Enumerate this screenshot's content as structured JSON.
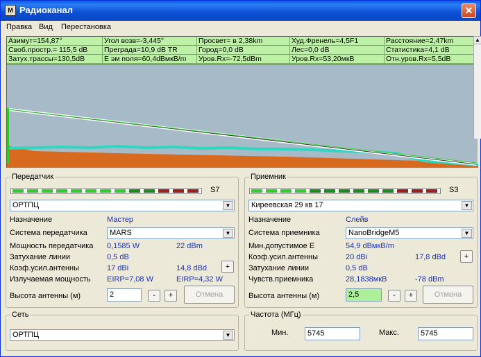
{
  "window": {
    "title": "Радиоканал",
    "app_icon": "radio-app-icon",
    "close_glyph": "✕"
  },
  "menu": [
    "Правка",
    "Вид",
    "Перестановка"
  ],
  "info": [
    [
      "Азимут=154,87°",
      "Угол возв=-3,445°",
      "Просвет= в 2,38km",
      "Худ.Френель=4,5F1",
      "Расстояние=2,47km"
    ],
    [
      "Своб.простр.= 115,5 dB",
      "Преграда=10,9 dB TR",
      "Город=0,0 dB",
      "Лес=0,0 dB",
      "Статистика=4,1 dB"
    ],
    [
      "Затух.трассы=130,5dB",
      "E эм поля=60,4dBмкВ/m",
      "Уров.Rx=-72,5dBm",
      "Уров.Rx=53,20мкВ",
      "Отн.уров.Rx=5,5dB"
    ]
  ],
  "transmitter": {
    "title": "Передатчик",
    "s_label": "S7",
    "site": "ОРТПЦ",
    "role_label": "Назначение",
    "role_value": "Мастер",
    "system_label": "Система передатчика",
    "system_value": "MARS",
    "power_label": "Мощность передатчика",
    "power_w": "0,1585 W",
    "power_dbm": "22 dBm",
    "line_loss_label": "Затухание линии",
    "line_loss": "0,5 dB",
    "gain_label": "Коэф.усил.антенны",
    "gain_dbi": "17 dBi",
    "gain_dbd": "14,8 dBd",
    "radiated_label": "Излучаемая мощность",
    "eirp_1": "EIRP=7,08 W",
    "eirp_2": "EIRP=4,32 W",
    "height_label": "Высота антенны (м)",
    "height_value": "2",
    "minus": "-",
    "plus": "+",
    "cancel": "Отмена",
    "led_colors": [
      "#33cc33",
      "#33cc33",
      "#33cc33",
      "#33cc33",
      "#33cc33",
      "#33cc33",
      "#33cc33",
      "#33cc33",
      "#1f8a1f",
      "#1f8a1f",
      "#9a2020",
      "#9a2020",
      "#9a2020"
    ]
  },
  "receiver": {
    "title": "Приемник",
    "s_label": "S3",
    "site": "Киреевская 29 кв 17",
    "role_label": "Назначение",
    "role_value": "Слейв",
    "system_label": "Система приемника",
    "system_value": "NanoBridgeM5",
    "min_e_label": "Мин.допустимое E",
    "min_e": "54,9 dBмкВ/m",
    "gain_label": "Коэф.усил.антенны",
    "gain_dbi": "20 dBi",
    "gain_dbd": "17,8 dBd",
    "line_loss_label": "Затухание линии",
    "line_loss": "0,5 dB",
    "sens_label": "Чувств.приемника",
    "sens_uv": "28,1838мкВ",
    "sens_dbm": "-78 dBm",
    "height_label": "Высота антенны (м)",
    "height_value": "2,5",
    "minus": "-",
    "plus": "+",
    "cancel": "Отмена",
    "led_colors": [
      "#33cc33",
      "#33cc33",
      "#33cc33",
      "#33cc33",
      "#1f8a1f",
      "#1f8a1f",
      "#1f8a1f",
      "#1f8a1f",
      "#1f8a1f",
      "#1f8a1f",
      "#9a2020",
      "#9a2020",
      "#9a2020"
    ]
  },
  "network": {
    "title": "Сеть",
    "value": "ОРТПЦ"
  },
  "frequency": {
    "title": "Частота (МГц)",
    "min_label": "Мин.",
    "min_value": "5745",
    "max_label": "Макс.",
    "max_value": "5745"
  },
  "colors": {
    "title_blue": "#0b4fd4",
    "info_green": "#bff0a8",
    "profile_bg": "#a6bac8",
    "value_blue": "#1b32b8"
  }
}
